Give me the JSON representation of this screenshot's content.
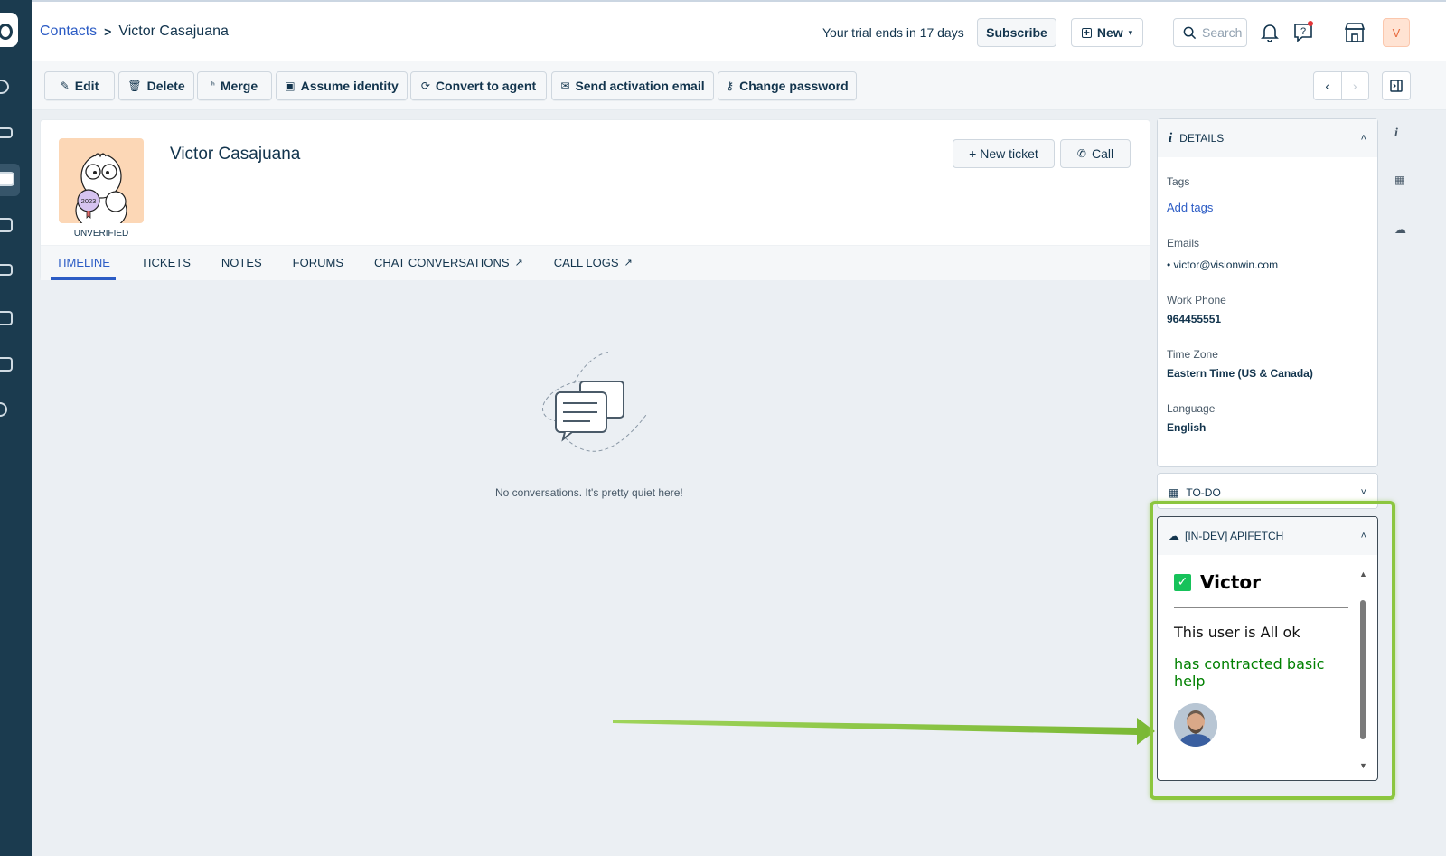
{
  "breadcrumb": {
    "parent": "Contacts",
    "separator": ">",
    "current": "Victor Casajuana"
  },
  "header": {
    "trial_text": "Your trial ends in 17 days",
    "subscribe_label": "Subscribe",
    "new_label": "New",
    "search_placeholder": "Search",
    "user_initial": "V"
  },
  "actions": {
    "edit": "Edit",
    "delete": "Delete",
    "merge": "Merge",
    "assume_identity": "Assume identity",
    "convert_to_agent": "Convert to agent",
    "send_activation_email": "Send activation email",
    "change_password": "Change password"
  },
  "profile": {
    "name": "Victor Casajuana",
    "status": "UNVERIFIED",
    "badge_year": "2023",
    "new_ticket_label": "+ New ticket",
    "call_label": "Call"
  },
  "tabs": [
    {
      "label": "TIMELINE"
    },
    {
      "label": "TICKETS"
    },
    {
      "label": "NOTES"
    },
    {
      "label": "FORUMS"
    },
    {
      "label": "CHAT CONVERSATIONS"
    },
    {
      "label": "CALL LOGS"
    }
  ],
  "timeline": {
    "empty_text": "No conversations. It's pretty quiet here!"
  },
  "details": {
    "title": "DETAILS",
    "tags_label": "Tags",
    "add_tags": "Add tags",
    "emails_label": "Emails",
    "email": "victor@visionwin.com",
    "work_phone_label": "Work Phone",
    "work_phone": "964455551",
    "timezone_label": "Time Zone",
    "timezone": "Eastern Time (US & Canada)",
    "language_label": "Language",
    "language": "English"
  },
  "todo": {
    "title": "TO-DO"
  },
  "apifetch": {
    "title": "[IN-DEV] APIFETCH",
    "name": "Victor",
    "status_text": "This user is All ok",
    "contract_text": "has contracted basic help"
  },
  "colors": {
    "nav_bg": "#1b3b4f",
    "link": "#2c5cc5",
    "highlight": "#8cc63f",
    "ok_green": "#008000"
  }
}
